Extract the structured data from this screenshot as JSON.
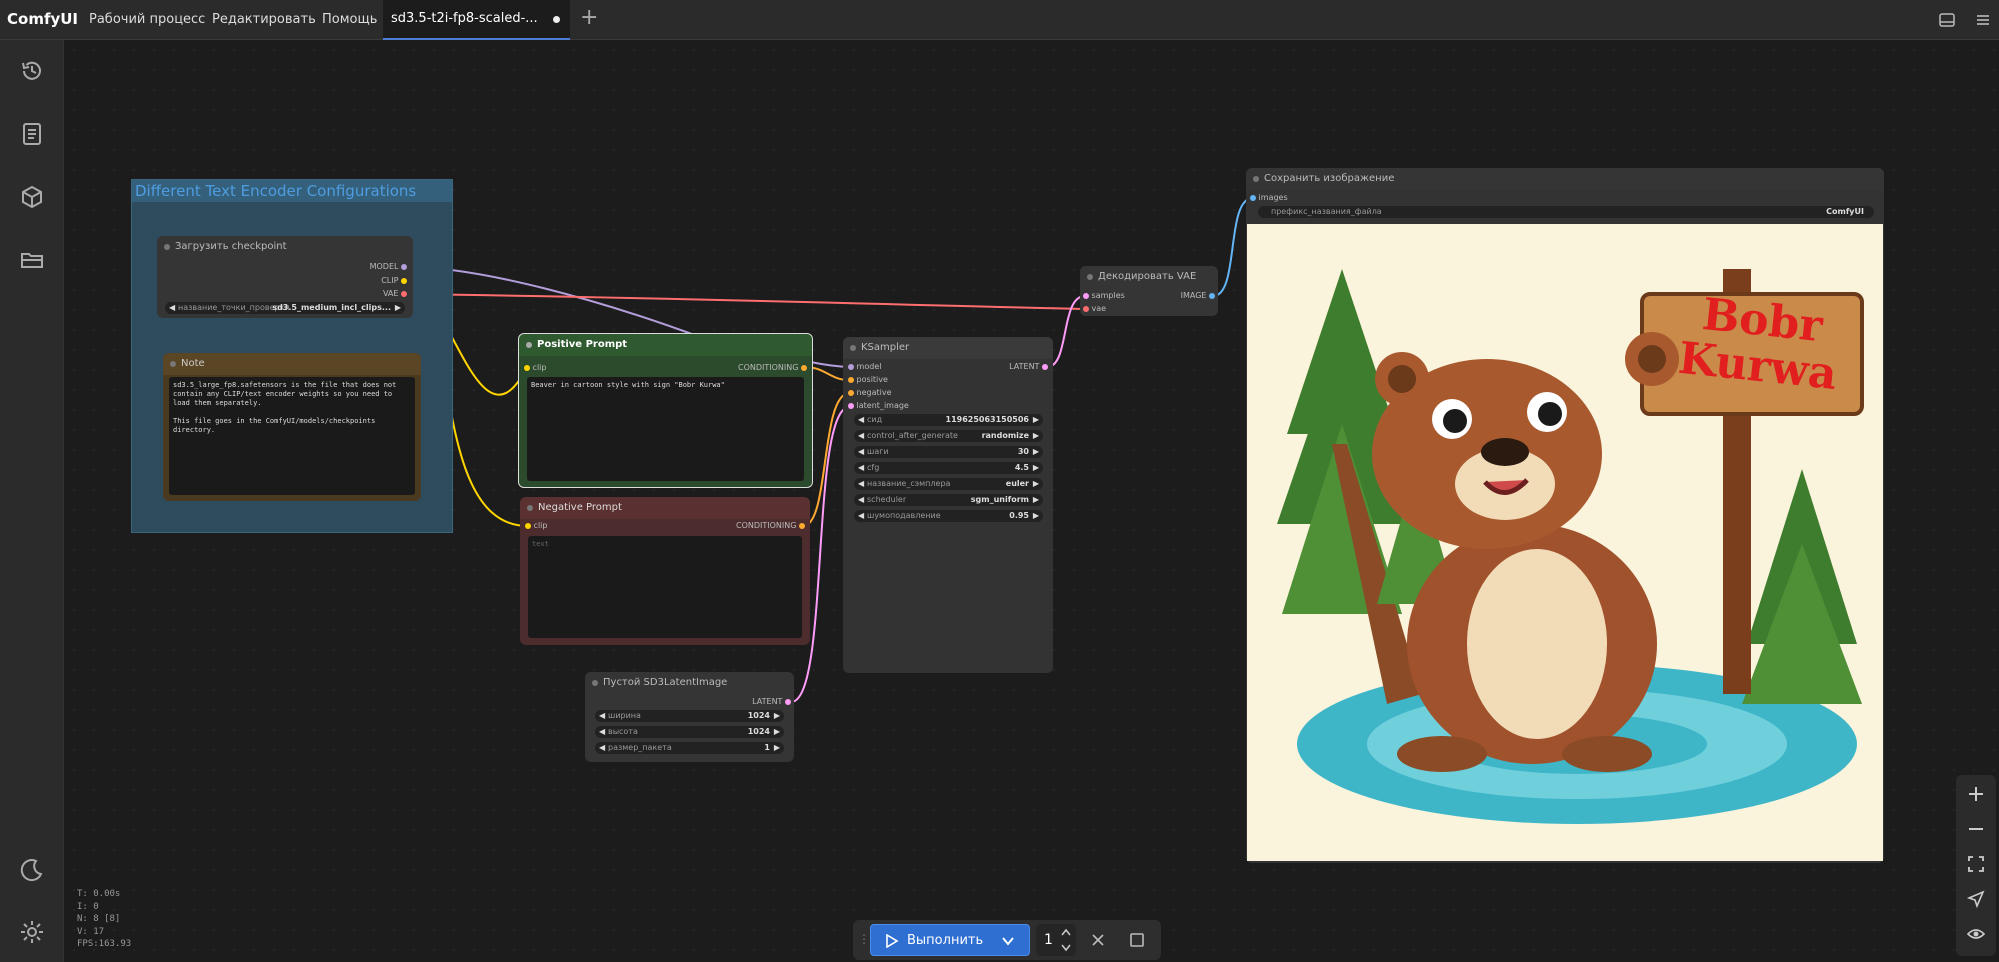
{
  "app": {
    "logo": "ComfyUI"
  },
  "menu": {
    "workflow": "Рабочий процесс",
    "edit": "Редактировать",
    "help": "Помощь"
  },
  "tab": {
    "label": "sd3.5-t2i-fp8-scaled-..."
  },
  "group": {
    "title": "Different Text Encoder Configurations"
  },
  "checkpoint_node": {
    "title": "Загрузить checkpoint",
    "outputs": [
      "MODEL",
      "CLIP",
      "VAE"
    ],
    "widget_label": "название_точки_проверки",
    "widget_value": "sd3.5_medium_incl_clips..."
  },
  "note_node": {
    "title": "Note",
    "text": "sd3.5_large_fp8.safetensors is the file that does not contain any CLIP/text encoder weights so you need to load them separately.\n\nThis file goes in the ComfyUI/models/checkpoints directory."
  },
  "positive_node": {
    "title": "Positive Prompt",
    "input": "clip",
    "output": "CONDITIONING",
    "text": "Beaver in cartoon style with sign \"Bobr Kurwa\""
  },
  "negative_node": {
    "title": "Negative Prompt",
    "input": "clip",
    "output": "CONDITIONING",
    "placeholder": "text"
  },
  "ksampler_node": {
    "title": "KSampler",
    "inputs": [
      "model",
      "positive",
      "negative",
      "latent_image"
    ],
    "output": "LATENT",
    "widgets": [
      {
        "label": "сид",
        "value": "119625063150506"
      },
      {
        "label": "control_after_generate",
        "value": "randomize"
      },
      {
        "label": "шаги",
        "value": "30"
      },
      {
        "label": "cfg",
        "value": "4.5"
      },
      {
        "label": "название_сэмплера",
        "value": "euler"
      },
      {
        "label": "scheduler",
        "value": "sgm_uniform"
      },
      {
        "label": "шумоподавление",
        "value": "0.95"
      }
    ]
  },
  "latent_node": {
    "title": "Пустой SD3LatentImage",
    "output": "LATENT",
    "widgets": [
      {
        "label": "ширина",
        "value": "1024"
      },
      {
        "label": "высота",
        "value": "1024"
      },
      {
        "label": "размер_пакета",
        "value": "1"
      }
    ]
  },
  "vae_node": {
    "title": "Декодировать VAE",
    "inputs": [
      "samples",
      "vae"
    ],
    "output": "IMAGE"
  },
  "save_node": {
    "title": "Сохранить изображение",
    "input": "images",
    "widget_label": "префикс_названия_файла",
    "widget_value": "ComfyUI",
    "image_sign_line1": "Bobr",
    "image_sign_line2": "Kurwa"
  },
  "stats": {
    "t": "T: 0.00s",
    "i": "I: 0",
    "n": "N: 8 [8]",
    "v": "V: 17",
    "fps": "FPS:163.93"
  },
  "run": {
    "label": "Выполнить",
    "batch": "1"
  },
  "colors": {
    "model": "#b39ddb",
    "clip": "#ffd500",
    "vae": "#ff6e6e",
    "conditioning": "#ffa931",
    "latent": "#ff9cf9",
    "image": "#64b5f6",
    "accent": "#2f6fd1"
  }
}
